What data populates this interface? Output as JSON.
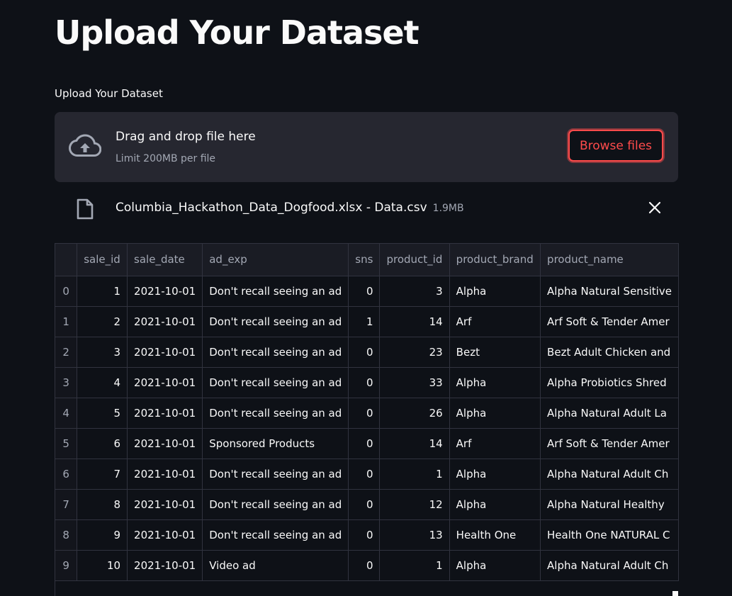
{
  "page": {
    "title": "Upload Your Dataset"
  },
  "uploader": {
    "label": "Upload Your Dataset",
    "drop_text": "Drag and drop file here",
    "limit_text": "Limit 200MB per file",
    "browse_label": "Browse files",
    "icon": "cloud-upload-icon"
  },
  "uploaded_file": {
    "name": "Columbia_Hackathon_Data_Dogfood.xlsx - Data.csv",
    "size": "1.9MB",
    "icon": "file-icon",
    "remove_icon": "close-icon"
  },
  "table": {
    "columns": [
      "",
      "sale_id",
      "sale_date",
      "ad_exp",
      "sns",
      "product_id",
      "product_brand",
      "product_name"
    ],
    "rows": [
      [
        "0",
        "1",
        "2021-10-01",
        "Don't recall seeing an ad",
        "0",
        "3",
        "Alpha",
        "Alpha Natural Sensitive"
      ],
      [
        "1",
        "2",
        "2021-10-01",
        "Don't recall seeing an ad",
        "1",
        "14",
        "Arf",
        "Arf Soft & Tender Amer"
      ],
      [
        "2",
        "3",
        "2021-10-01",
        "Don't recall seeing an ad",
        "0",
        "23",
        "Bezt",
        "Bezt Adult Chicken and"
      ],
      [
        "3",
        "4",
        "2021-10-01",
        "Don't recall seeing an ad",
        "0",
        "33",
        "Alpha",
        "Alpha Probiotics Shred"
      ],
      [
        "4",
        "5",
        "2021-10-01",
        "Don't recall seeing an ad",
        "0",
        "26",
        "Alpha",
        "Alpha Natural Adult La"
      ],
      [
        "5",
        "6",
        "2021-10-01",
        "Sponsored Products",
        "0",
        "14",
        "Arf",
        "Arf Soft & Tender Amer"
      ],
      [
        "6",
        "7",
        "2021-10-01",
        "Don't recall seeing an ad",
        "0",
        "1",
        "Alpha",
        "Alpha Natural Adult Ch"
      ],
      [
        "7",
        "8",
        "2021-10-01",
        "Don't recall seeing an ad",
        "0",
        "12",
        "Alpha",
        "Alpha Natural Healthy"
      ],
      [
        "8",
        "9",
        "2021-10-01",
        "Don't recall seeing an ad",
        "0",
        "13",
        "Health One",
        "Health One NATURAL C"
      ],
      [
        "9",
        "10",
        "2021-10-01",
        "Video ad",
        "0",
        "1",
        "Alpha",
        "Alpha Natural Adult Ch"
      ]
    ]
  },
  "colors": {
    "background": "#0e1117",
    "panel": "#262730",
    "accent": "#ff4b4b",
    "muted_text": "#a3a8b4"
  }
}
